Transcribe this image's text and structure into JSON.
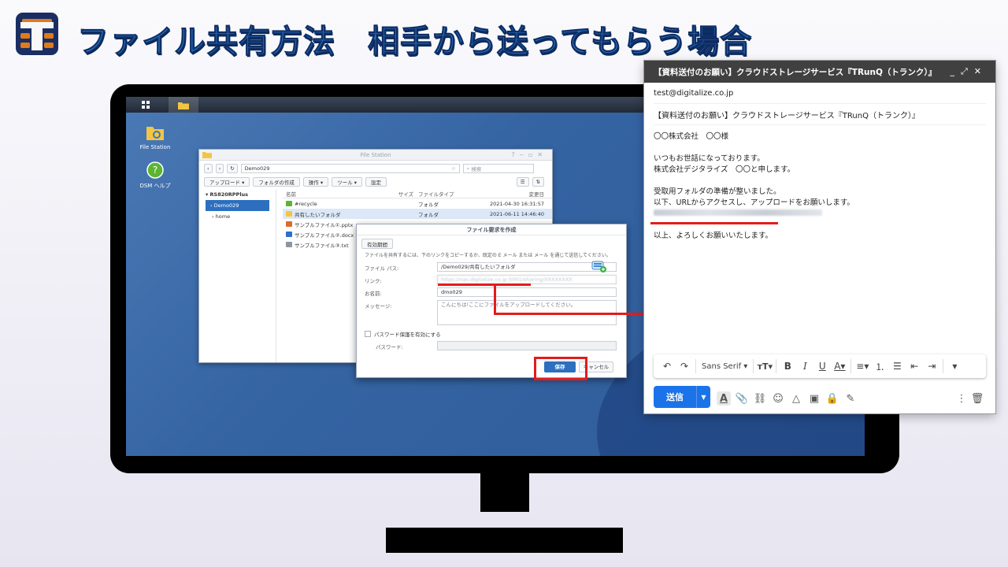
{
  "title": "ファイル共有方法　相手から送ってもらう場合",
  "dsm": {
    "desktop_icons": [
      {
        "label": "File Station",
        "icon": "file-station-icon"
      },
      {
        "label": "DSM ヘルプ",
        "icon": "help-icon"
      }
    ],
    "file_station": {
      "window_title": "File Station",
      "path": "Demo029",
      "search_placeholder": "検索",
      "toolbar": [
        "アップロード ▾",
        "フォルダの作成",
        "操作 ▾",
        "ツール ▾",
        "設定"
      ],
      "tree": {
        "root": "RS820RPPlus",
        "selected": "Demo029",
        "other": "home"
      },
      "columns": [
        "名前",
        "サイズ",
        "ファイルタイプ",
        "変更日"
      ],
      "files": [
        {
          "name": "#recycle",
          "size": "",
          "type": "フォルダ",
          "modified": "2021-04-30 16:31:57",
          "icon": "recycle-folder-icon",
          "highlighted": false
        },
        {
          "name": "共有したいフォルダ",
          "size": "",
          "type": "フォルダ",
          "modified": "2021-06-11 14:46:40",
          "icon": "folder-icon",
          "highlighted": true
        },
        {
          "name": "サンプルファイル①.pptx",
          "size": "",
          "type": "",
          "modified": "",
          "icon": "pptx-icon",
          "highlighted": false
        },
        {
          "name": "サンプルファイル②.docx",
          "size": "",
          "type": "",
          "modified": "",
          "icon": "docx-icon",
          "highlighted": false
        },
        {
          "name": "サンプルファイル③.txt",
          "size": "",
          "type": "",
          "modified": "",
          "icon": "txt-icon",
          "highlighted": false
        }
      ]
    },
    "share_dialog": {
      "title": "ファイル要求を作成",
      "tab": "有効期間",
      "description": "ファイルを共有するには、下のリンクをコピーするか、既定の E メール または メール を通じて送信してください。",
      "file_path_label": "ファイル パス:",
      "file_path_value": "/Demo029/共有したいフォルダ",
      "link_label": "リンク:",
      "link_value": "https://nas.digitalize.co.jp:5001/sharing/XXXXXXXX",
      "name_label": "お名前:",
      "name_value": "dmo029",
      "message_label": "メッセージ:",
      "message_value": "こんにちは!ここにファイルをアップロードしてください。",
      "password_checkbox": "パスワード保護を有効にする",
      "password_label": "パスワード:",
      "save_button": "保存",
      "cancel_button": "キャンセル"
    }
  },
  "gmail": {
    "header_title": "【資料送付のお願い】クラウドストレージサービス『TRunQ（トランク）』",
    "header_controls": [
      "_",
      "⤢",
      "✕"
    ],
    "to": "test@digitalize.co.jp",
    "subject": "【資料送付のお願い】クラウドストレージサービス『TRunQ（トランク）』",
    "body_lines": [
      "〇〇株式会社　〇〇様",
      "",
      "いつもお世話になっております。",
      "株式会社デジタライズ　〇〇と申します。",
      "",
      "受取用フォルダの準備が整いました。",
      "以下、URLからアクセスし、アップロードをお願いします。"
    ],
    "link_blurred": "https://nas.digitalize.co.jp:5001/sharing/XXXXXXXX",
    "closing": "以上、よろしくお願いいたします。",
    "font_name": "Sans Serif",
    "send_label": "送信",
    "accent_color": "#1a73e8"
  },
  "colors": {
    "annotation_red": "#e31c1c",
    "title_blue": "#2a78c8",
    "dsm_selected": "#2c6fbf"
  }
}
